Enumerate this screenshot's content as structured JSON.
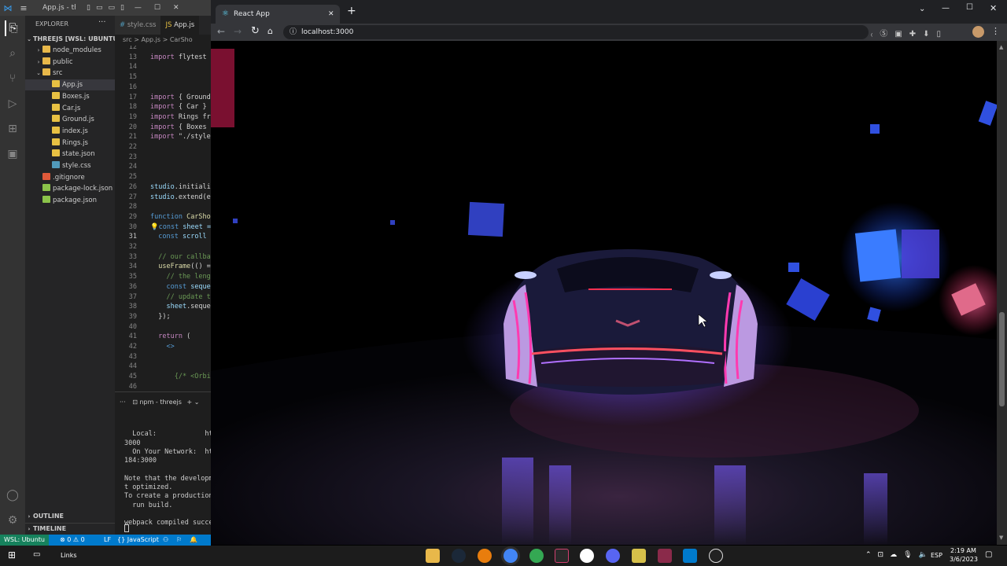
{
  "vscode": {
    "window_title": "App.js - th...",
    "explorer": {
      "header": "EXPLORER",
      "project": "THREEJS [WSL: UBUNTU]",
      "items": [
        {
          "label": "node_modules",
          "kind": "folder"
        },
        {
          "label": "public",
          "kind": "folder"
        },
        {
          "label": "src",
          "kind": "folder-open"
        },
        {
          "label": "App.js",
          "kind": "js"
        },
        {
          "label": "Boxes.js",
          "kind": "js"
        },
        {
          "label": "Car.js",
          "kind": "js"
        },
        {
          "label": "Ground.js",
          "kind": "js"
        },
        {
          "label": "index.js",
          "kind": "js"
        },
        {
          "label": "Rings.js",
          "kind": "js"
        },
        {
          "label": "state.json",
          "kind": "json"
        },
        {
          "label": "style.css",
          "kind": "css"
        },
        {
          "label": ".gitignore",
          "kind": "git"
        },
        {
          "label": "package-lock.json",
          "kind": "npm"
        },
        {
          "label": "package.json",
          "kind": "npm"
        }
      ],
      "outline": "OUTLINE",
      "timeline": "TIMELINE"
    },
    "tabs": [
      "style.css",
      "App.js"
    ],
    "breadcrumb": "src > App.js > CarSho",
    "code_lines": [
      {
        "n": "12",
        "t": ""
      },
      {
        "n": "13",
        "t": "import flytest"
      },
      {
        "n": "14",
        "t": ""
      },
      {
        "n": "15",
        "t": ""
      },
      {
        "n": "16",
        "t": ""
      },
      {
        "n": "17",
        "t": "import { Ground"
      },
      {
        "n": "18",
        "t": "import { Car }"
      },
      {
        "n": "19",
        "t": "import Rings fr"
      },
      {
        "n": "20",
        "t": "import { Boxes"
      },
      {
        "n": "21",
        "t": "import \"./style"
      },
      {
        "n": "22",
        "t": ""
      },
      {
        "n": "23",
        "t": ""
      },
      {
        "n": "24",
        "t": ""
      },
      {
        "n": "25",
        "t": ""
      },
      {
        "n": "26",
        "t": "studio.initiali"
      },
      {
        "n": "27",
        "t": "studio.extend(e"
      },
      {
        "n": "28",
        "t": ""
      },
      {
        "n": "29",
        "t": "function CarSho"
      },
      {
        "n": "30",
        "t": "const sheet ="
      },
      {
        "n": "31",
        "t": "  const scroll"
      },
      {
        "n": "32",
        "t": ""
      },
      {
        "n": "33",
        "t": "  // our callba"
      },
      {
        "n": "34",
        "t": "  useFrame(() ="
      },
      {
        "n": "35",
        "t": "    // the leng"
      },
      {
        "n": "36",
        "t": "    const seque"
      },
      {
        "n": "37",
        "t": "    // update t"
      },
      {
        "n": "38",
        "t": "    sheet.seque"
      },
      {
        "n": "39",
        "t": "  });"
      },
      {
        "n": "40",
        "t": ""
      },
      {
        "n": "41",
        "t": "  return ("
      },
      {
        "n": "42",
        "t": "    <>"
      },
      {
        "n": "43",
        "t": ""
      },
      {
        "n": "44",
        "t": ""
      },
      {
        "n": "45",
        "t": "      {/* <Orbi"
      },
      {
        "n": "46",
        "t": ""
      }
    ],
    "terminal": {
      "tab_label": "npm - threejs",
      "lines": [
        "",
        "  Local:            htt",
        "3000",
        "  On Your Network:  htt",
        "184:3000",
        "",
        "Note that the developme",
        "t optimized.",
        "To create a production",
        "  run build.",
        "",
        "webpack compiled succes"
      ]
    },
    "status": {
      "remote": "WSL: Ubuntu",
      "problems": "⊗ 0 ⚠ 0",
      "eol": "LF",
      "language": "{} JavaScript"
    }
  },
  "chrome": {
    "tab_title": "React App",
    "url": "localhost:3000"
  },
  "taskbar": {
    "links": "Links",
    "lang": "ESP",
    "time": "2:19 AM",
    "date": "3/6/2023"
  },
  "colors": {
    "vscode_blue": "#007acc",
    "chrome_bg": "#202124"
  }
}
